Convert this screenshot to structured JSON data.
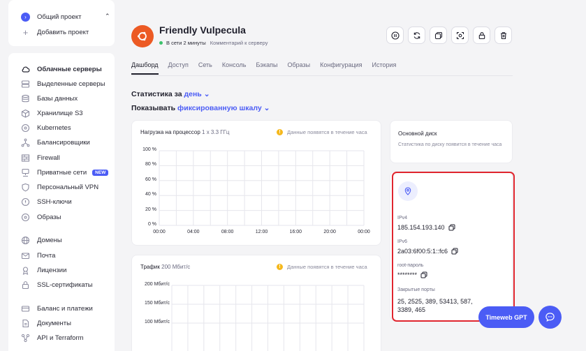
{
  "sidebar": {
    "project": {
      "label": "Общий проект",
      "add_label": "Добавить проект"
    },
    "items": [
      {
        "label": "Облачные серверы",
        "icon": "cloud-icon",
        "active": true
      },
      {
        "label": "Выделенные серверы",
        "icon": "server-icon"
      },
      {
        "label": "Базы данных",
        "icon": "database-icon"
      },
      {
        "label": "Хранилище S3",
        "icon": "storage-icon"
      },
      {
        "label": "Kubernetes",
        "icon": "kubernetes-icon"
      },
      {
        "label": "Балансировщики",
        "icon": "balancer-icon"
      },
      {
        "label": "Firewall",
        "icon": "firewall-icon"
      },
      {
        "label": "Приватные сети",
        "icon": "network-icon",
        "badge": "NEW"
      },
      {
        "label": "Персональный VPN",
        "icon": "shield-icon"
      },
      {
        "label": "SSH-ключи",
        "icon": "key-icon"
      },
      {
        "label": "Образы",
        "icon": "image-icon"
      },
      {
        "label": "Домены",
        "icon": "globe-icon"
      },
      {
        "label": "Почта",
        "icon": "mail-icon"
      },
      {
        "label": "Лицензии",
        "icon": "license-icon"
      },
      {
        "label": "SSL-сертификаты",
        "icon": "lock-icon"
      },
      {
        "label": "Баланс и платежи",
        "icon": "card-icon"
      },
      {
        "label": "Документы",
        "icon": "document-icon"
      },
      {
        "label": "API и Terraform",
        "icon": "api-icon"
      }
    ]
  },
  "server": {
    "name": "Friendly Vulpecula",
    "status": "В сети 2 минуты",
    "comment_link": "Комментарий к серверу",
    "logo_color": "#ec5a24"
  },
  "toolbar": [
    "pause-icon",
    "reload-icon",
    "clone-icon",
    "snapshot-icon",
    "lock-icon",
    "delete-icon"
  ],
  "tabs": [
    "Дашборд",
    "Доступ",
    "Сеть",
    "Консоль",
    "Бэкапы",
    "Образы",
    "Конфигурация",
    "История"
  ],
  "stats": {
    "period_prefix": "Статистика за",
    "period_value": "день",
    "scale_prefix": "Показывать",
    "scale_value": "фиксированную шкалу"
  },
  "cpu_chart": {
    "title": "Нагрузка на процессор",
    "subtitle": "1 x 3.3 ГГц",
    "notice": "Данные появятся в течение часа",
    "y_ticks": [
      "100 %",
      "80 %",
      "60 %",
      "40 %",
      "20 %",
      "0 %"
    ],
    "x_ticks": [
      "00:00",
      "04:00",
      "08:00",
      "12:00",
      "16:00",
      "20:00",
      "00:00"
    ]
  },
  "traffic_chart": {
    "title": "Трафик",
    "subtitle": "200 Мбит/с",
    "notice": "Данные появятся в течение часа",
    "y_ticks": [
      "200 Мбит/с",
      "150 Мбит/с",
      "100 Мбит/с"
    ]
  },
  "disk": {
    "title": "Основной диск",
    "notice": "Статистика по диску появится в течение часа"
  },
  "network_info": {
    "ipv4_label": "IPv4",
    "ipv4": "185.154.193.140",
    "ipv6_label": "IPv6",
    "ipv6": "2a03:6f00:5:1::fc6",
    "password_label": "root-пароль",
    "password": "********",
    "ports_label": "Закрытые порты",
    "ports": "25, 2525, 389, 53413, 587, 3389, 465"
  },
  "fab": {
    "gpt_label": "Timeweb GPT"
  },
  "colors": {
    "accent": "#4b5cf5",
    "online": "#3cc26c",
    "warning": "#f5b81c",
    "highlight": "#e0262f"
  }
}
